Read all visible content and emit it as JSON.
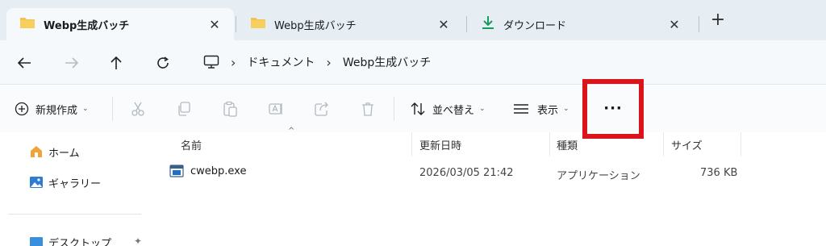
{
  "tabs": [
    {
      "label": "Webp生成バッチ",
      "icon": "folder-icon",
      "active": true
    },
    {
      "label": "Webp生成バッチ",
      "icon": "folder-icon",
      "active": false
    },
    {
      "label": "ダウンロード",
      "icon": "download-icon",
      "active": false
    }
  ],
  "new_tab_label": "+",
  "tab_close_label": "✕",
  "breadcrumb": {
    "items": [
      "ドキュメント",
      "Webp生成バッチ"
    ],
    "separator": "›"
  },
  "toolbar": {
    "new_label": "新規作成",
    "sort_label": "並べ替え",
    "view_label": "表示",
    "more_label": "···"
  },
  "sidebar": {
    "items": [
      {
        "label": "ホーム",
        "icon": "home-icon"
      },
      {
        "label": "ギャラリー",
        "icon": "gallery-icon"
      },
      {
        "label": "デスクトップ",
        "icon": "desktop-icon"
      }
    ]
  },
  "columns": {
    "name": "名前",
    "modified": "更新日時",
    "type": "種類",
    "size": "サイズ"
  },
  "files": [
    {
      "name": "cwebp.exe",
      "modified": "2026/03/05 21:42",
      "type": "アプリケーション",
      "size": "736 KB"
    }
  ],
  "colors": {
    "highlight": "#d9141b",
    "folder": "#f2c14e",
    "download": "#1a9b5a"
  }
}
